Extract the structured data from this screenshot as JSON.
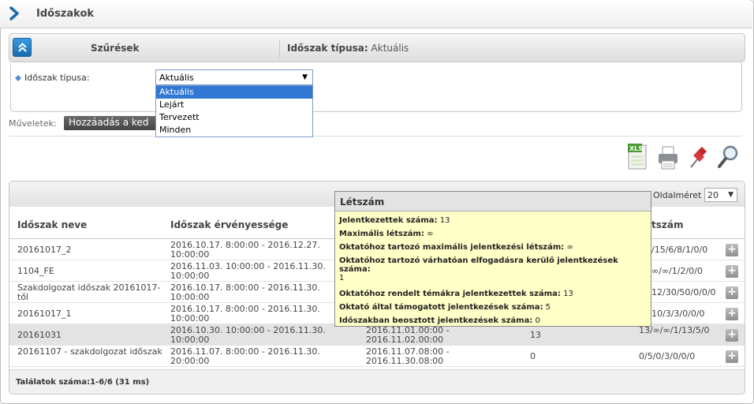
{
  "page": {
    "title": "Időszakok"
  },
  "filter_bar": {
    "label": "Szűrések",
    "summary_label": "Időszak típusa:",
    "summary_value": "Aktuális"
  },
  "filter": {
    "label": "Időszak típusa:",
    "selected": "Aktuális",
    "options": [
      "Aktuális",
      "Lejárt",
      "Tervezett",
      "Minden"
    ]
  },
  "operations": {
    "label": "Műveletek:",
    "add_button": "Hozzáadás a ked"
  },
  "toolbar": {
    "icons": [
      "xls-export-icon",
      "print-icon",
      "pin-icon",
      "search-icon"
    ],
    "xls_text": "XLS"
  },
  "grid": {
    "page_size_label": "Oldalméret",
    "page_size": "20",
    "columns": [
      "Időszak neve",
      "Időszak érvényessége",
      "",
      "",
      "tszám"
    ],
    "rows": [
      {
        "name": "20161017_2",
        "validity": "2016.10.17. 8:00:00 - 2016.12.27. 10:00:00",
        "col3": "",
        "col4": "",
        "stats": "/15/6/8/1/0/0"
      },
      {
        "name": "1104_FE",
        "validity": "2016.11.03. 10:00:00 - 2016.11.30. 10:00:00",
        "col3": "",
        "col4": "",
        "stats": "∞/∞/1/2/0/0"
      },
      {
        "name": "Szakdolgozat időszak 20161017-től",
        "validity": "2016.10.17. 8:00:00 - 2016.11.30. 10:00:00",
        "col3": "",
        "col4": "",
        "stats": "12/30/50/0/0/0"
      },
      {
        "name": "20161017_1",
        "validity": "2016.10.17. 8:00:00 - 2016.11.30. 10:00:00",
        "col3": "",
        "col4": "",
        "stats": "10/3/3/0/0/0"
      },
      {
        "name": "20161031",
        "validity": "2016.10.30. 10:00:00 - 2016.11.30. 10:00:00",
        "col3": "2016.11.01.00:00 - 2016.11.02.00:00",
        "col4": "13",
        "stats": "13/∞/∞/1/13/5/0"
      },
      {
        "name": "20161107 - szakdolgozat időszak",
        "validity": "2016.11.07. 8:00:00 - 2016.11.30. 20:00:00",
        "col3": "2016.11.07.08:00 - 2016.11.30.08:00",
        "col4": "0",
        "stats": "0/5/0/3/0/0/0"
      }
    ],
    "footer": "Találatok száma:1-6/6 (31 ms)"
  },
  "tooltip": {
    "title": "Létszám",
    "lines": [
      {
        "label": "Jelentkezettek száma:",
        "value": "13"
      },
      {
        "label": "Maximális létszám:",
        "value": "∞"
      },
      {
        "label": "Oktatóhoz tartozó maximális jelentkezési létszám:",
        "value": "∞"
      },
      {
        "label": "Oktatóhoz tartozó várhatóan elfogadásra kerülő jelentkezések száma:",
        "value": "1"
      },
      {
        "label": "Oktatóhoz rendelt témákra jelentkezettek száma:",
        "value": "13"
      },
      {
        "label": "Oktató által támogatott jelentkezések száma:",
        "value": "5"
      },
      {
        "label": "Időszakban beosztott jelentkezések száma:",
        "value": "0"
      }
    ]
  },
  "colors": {
    "accent": "#1a6bb0",
    "selection": "#3178d4",
    "tooltip_bg": "#ffffc8"
  }
}
